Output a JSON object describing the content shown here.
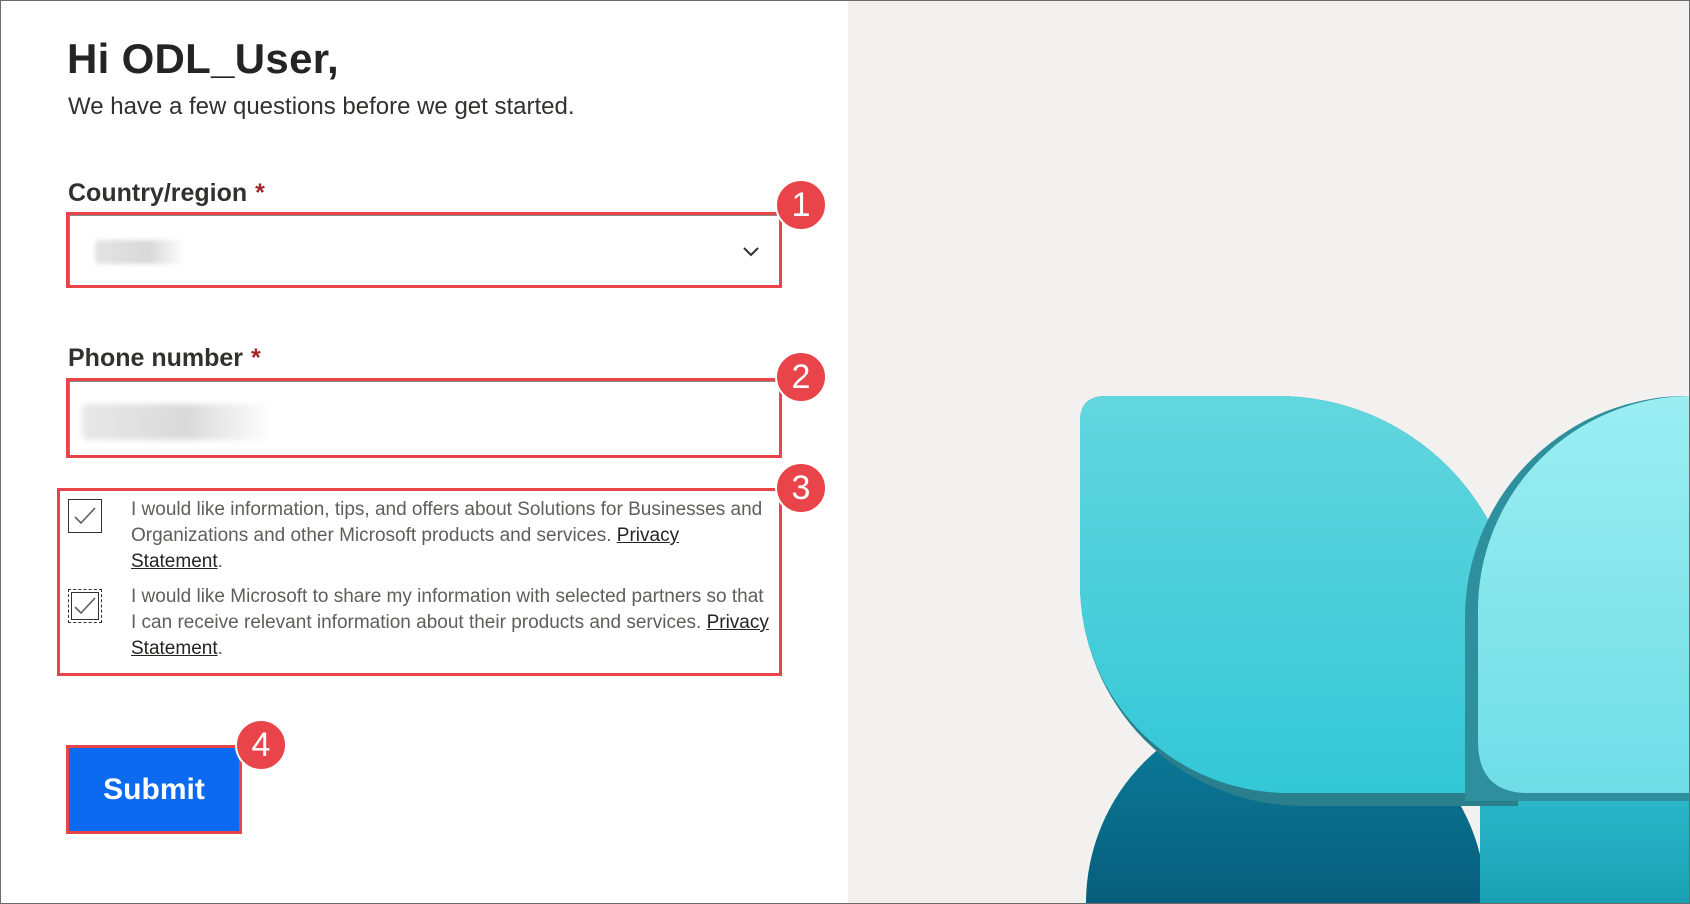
{
  "greeting": "Hi ODL_User,",
  "subtitle": "We have a few questions before we get started.",
  "form": {
    "country_label": "Country/region",
    "phone_label": "Phone number",
    "required_marker": "*",
    "country_value": "",
    "phone_value": ""
  },
  "consents": [
    {
      "text": "I would like information, tips, and offers about Solutions for Businesses and Organizations and other Microsoft products and services. ",
      "link": "Privacy Statement",
      "suffix": ".",
      "checked": true
    },
    {
      "text": "I would like Microsoft to share my information with selected partners so that I can receive relevant information about their products and services. ",
      "link": "Privacy Statement",
      "suffix": ".",
      "checked": true
    }
  ],
  "submit_label": "Submit",
  "annotations": [
    "1",
    "2",
    "3",
    "4"
  ],
  "colors": {
    "accent": "#0b6af0",
    "highlight": "#e8444a",
    "required": "#a4262c",
    "panel_bg": "#f2f1f0"
  },
  "icons": {
    "dropdown": "chevron-down-icon",
    "checkbox_check": "checkmark-icon"
  }
}
